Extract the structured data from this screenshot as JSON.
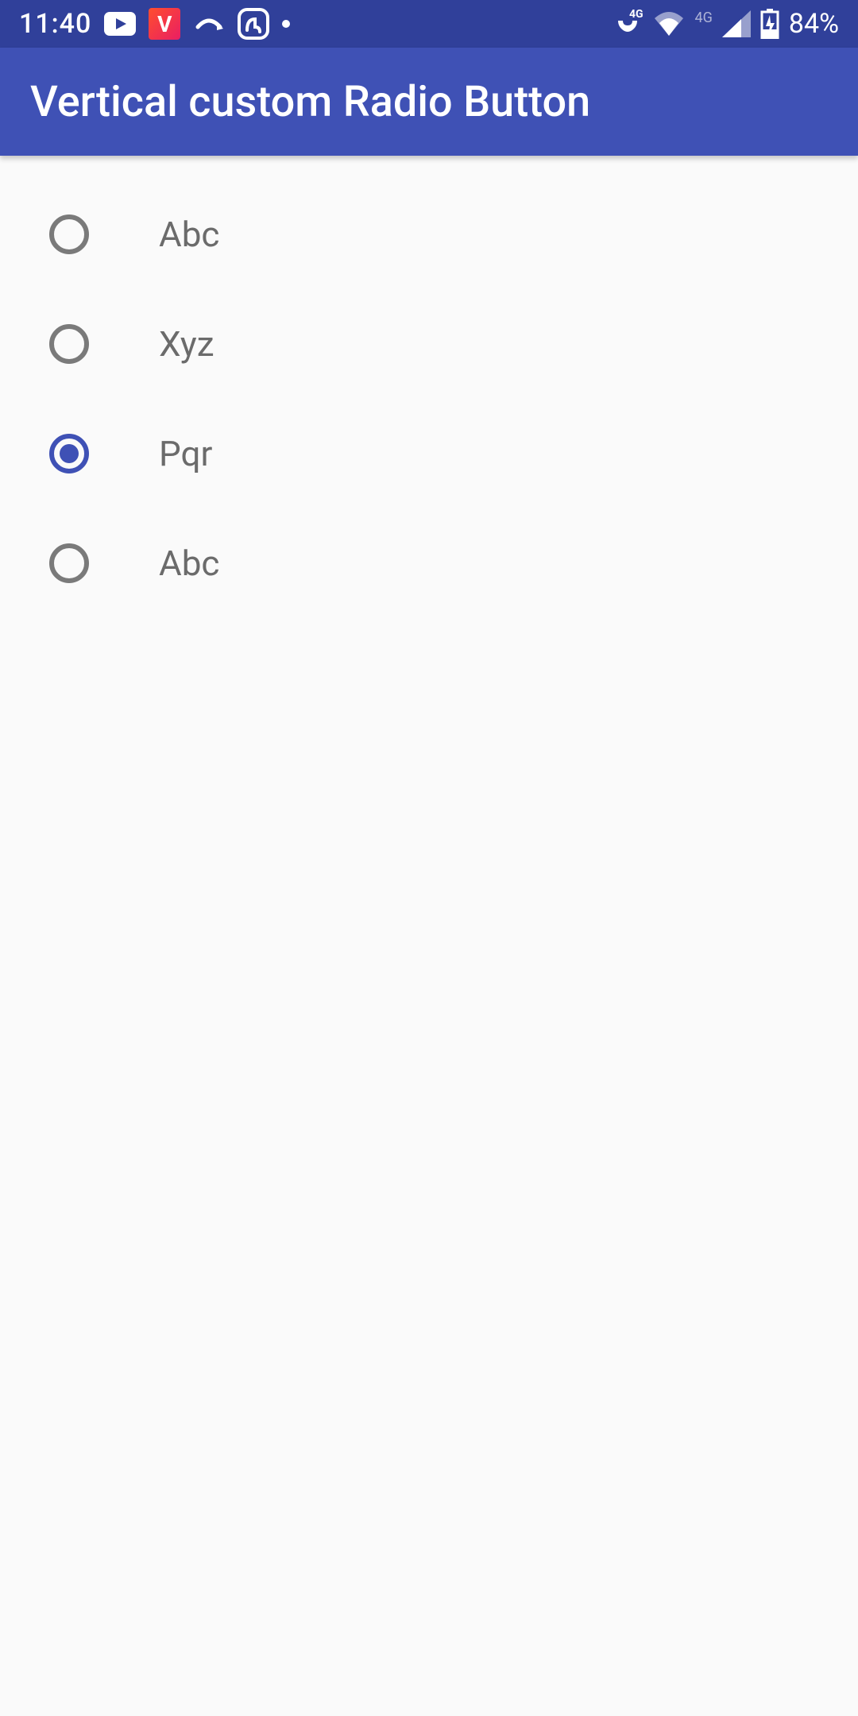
{
  "status": {
    "time": "11:40",
    "battery": "84%",
    "icons": {
      "youtube": "youtube-icon",
      "vapp": "V",
      "missed_call": "missed-call-icon",
      "saavn": "saavn-icon",
      "dot": "dot-icon",
      "phone_4g": "phone-4g-icon",
      "wifi": "wifi-icon",
      "signal_4g_label": "4G",
      "signal": "signal-icon",
      "battery_charging": "battery-charging-icon"
    }
  },
  "header": {
    "title": "Vertical custom Radio Button"
  },
  "radio": {
    "items": [
      {
        "label": "Abc",
        "selected": false
      },
      {
        "label": "Xyz",
        "selected": false
      },
      {
        "label": "Pqr",
        "selected": true
      },
      {
        "label": "Abc",
        "selected": false
      }
    ]
  }
}
